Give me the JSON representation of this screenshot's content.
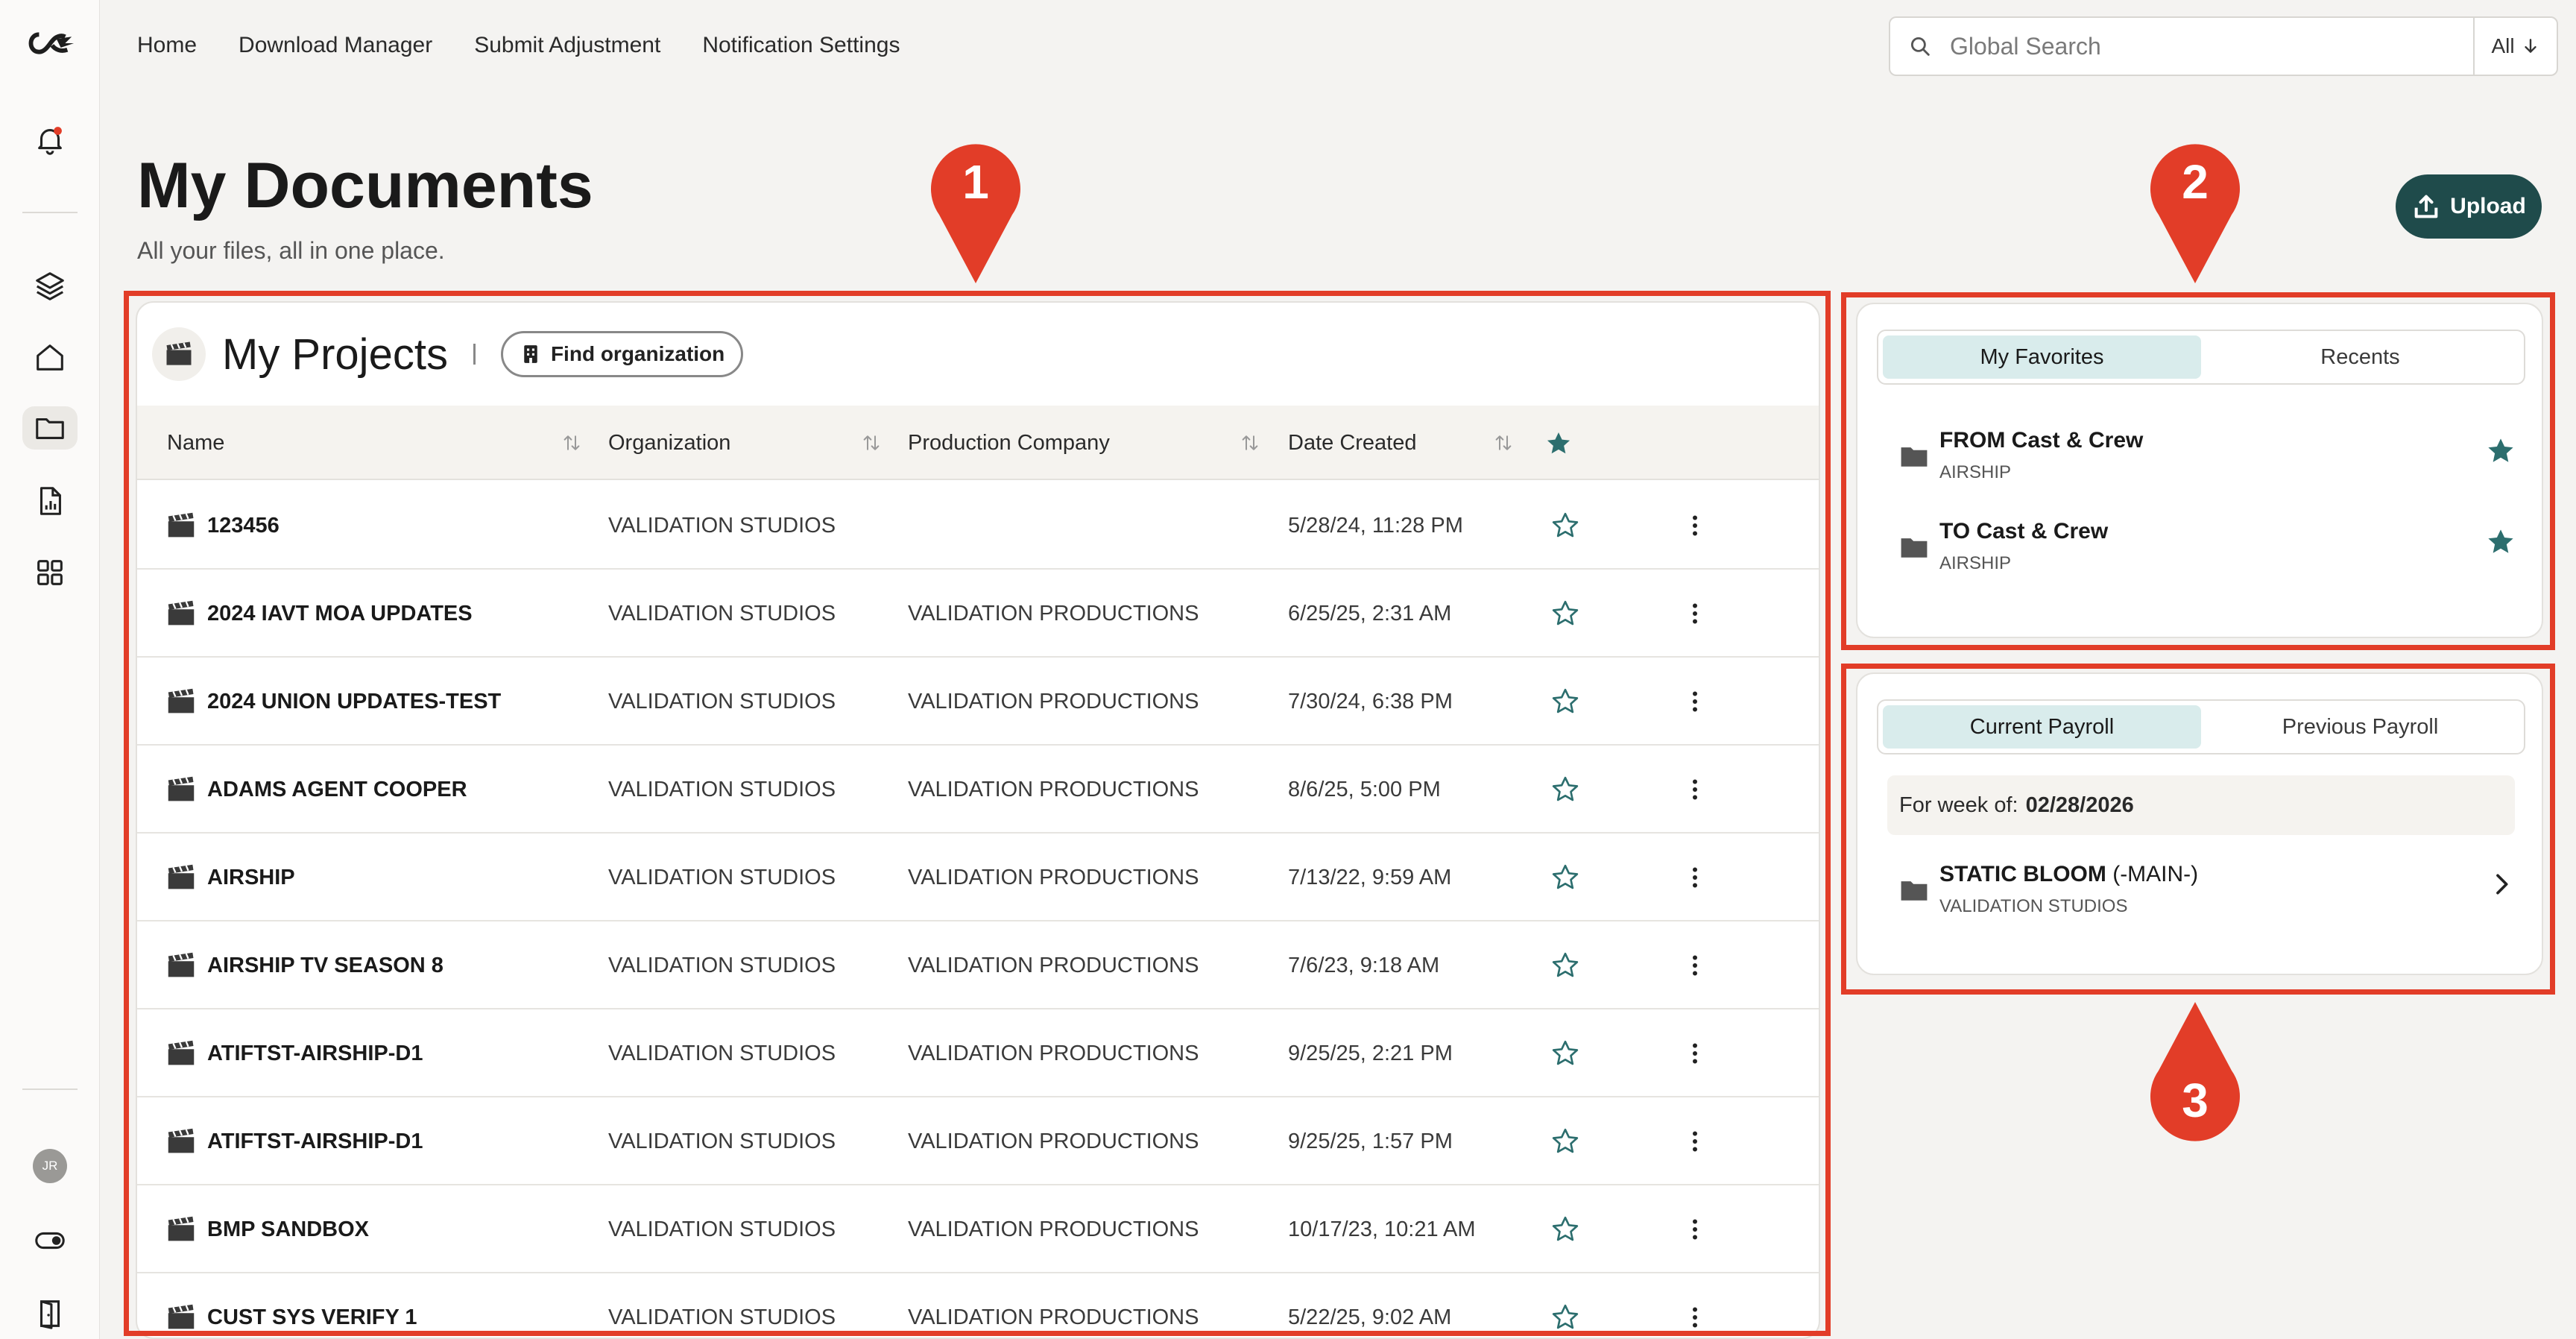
{
  "nav": {
    "links": [
      "Home",
      "Download Manager",
      "Submit Adjustment",
      "Notification Settings"
    ]
  },
  "search": {
    "placeholder": "Global Search",
    "scope": "All"
  },
  "page": {
    "title": "My Documents",
    "subtitle": "All your files, all in one place."
  },
  "upload": {
    "label": "Upload"
  },
  "sidebar": {
    "avatar_initials": "JR"
  },
  "annotations": [
    "1",
    "2",
    "3"
  ],
  "projects": {
    "title": "My Projects",
    "find_label": "Find organization",
    "columns": {
      "name": "Name",
      "organization": "Organization",
      "production_company": "Production Company",
      "date_created": "Date Created"
    },
    "rows": [
      {
        "name": "123456",
        "organization": "VALIDATION STUDIOS",
        "production_company": "",
        "date": "5/28/24, 11:28 PM"
      },
      {
        "name": "2024 IAVT MOA UPDATES",
        "organization": "VALIDATION STUDIOS",
        "production_company": "VALIDATION PRODUCTIONS",
        "date": "6/25/25, 2:31 AM"
      },
      {
        "name": "2024 UNION UPDATES-TEST",
        "organization": "VALIDATION STUDIOS",
        "production_company": "VALIDATION PRODUCTIONS",
        "date": "7/30/24, 6:38 PM"
      },
      {
        "name": "ADAMS AGENT COOPER",
        "organization": "VALIDATION STUDIOS",
        "production_company": "VALIDATION PRODUCTIONS",
        "date": "8/6/25, 5:00 PM"
      },
      {
        "name": "AIRSHIP",
        "organization": "VALIDATION STUDIOS",
        "production_company": "VALIDATION PRODUCTIONS",
        "date": "7/13/22, 9:59 AM"
      },
      {
        "name": "AIRSHIP TV SEASON 8",
        "organization": "VALIDATION STUDIOS",
        "production_company": "VALIDATION PRODUCTIONS",
        "date": "7/6/23, 9:18 AM"
      },
      {
        "name": "ATIFTST-AIRSHIP-D1",
        "organization": "VALIDATION STUDIOS",
        "production_company": "VALIDATION PRODUCTIONS",
        "date": "9/25/25, 2:21 PM"
      },
      {
        "name": "ATIFTST-AIRSHIP-D1",
        "organization": "VALIDATION STUDIOS",
        "production_company": "VALIDATION PRODUCTIONS",
        "date": "9/25/25, 1:57 PM"
      },
      {
        "name": "BMP SANDBOX",
        "organization": "VALIDATION STUDIOS",
        "production_company": "VALIDATION PRODUCTIONS",
        "date": "10/17/23, 10:21 AM"
      },
      {
        "name": "CUST SYS VERIFY 1",
        "organization": "VALIDATION STUDIOS",
        "production_company": "VALIDATION PRODUCTIONS",
        "date": "5/22/25, 9:02 AM"
      }
    ]
  },
  "favorites": {
    "tabs": [
      "My Favorites",
      "Recents"
    ],
    "items": [
      {
        "name": "FROM Cast & Crew",
        "org": "AIRSHIP"
      },
      {
        "name": "TO Cast & Crew",
        "org": "AIRSHIP"
      }
    ]
  },
  "payroll": {
    "tabs": [
      "Current Payroll",
      "Previous Payroll"
    ],
    "week_label": "For week of:",
    "week_date": "02/28/2026",
    "item": {
      "name": "STATIC BLOOM",
      "suffix": "(-MAIN-)",
      "org": "VALIDATION STUDIOS"
    }
  },
  "colors": {
    "accent": "#1f4b4b",
    "annotation": "#e23d28",
    "tab_active": "#d9ecec",
    "star": "#2c6e6e"
  }
}
